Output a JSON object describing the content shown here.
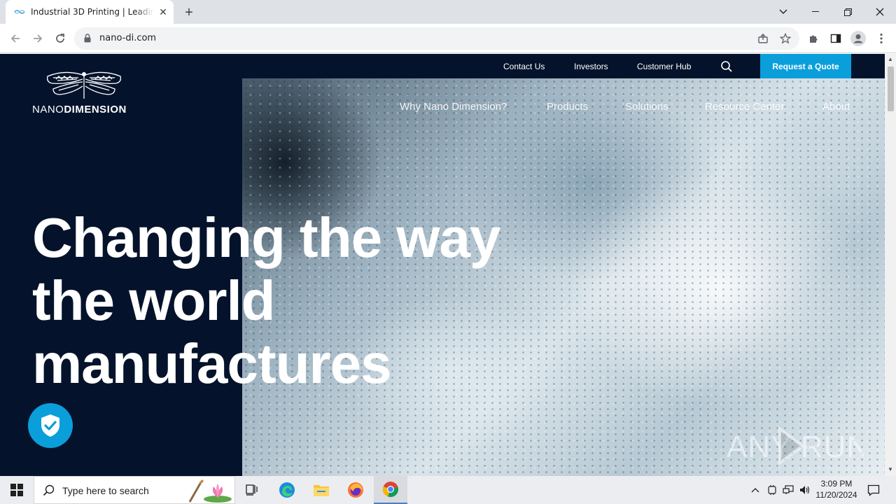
{
  "browser": {
    "tab_title": "Industrial 3D Printing | Leading in",
    "url": "nano-di.com"
  },
  "site": {
    "logo_text_left": "NANO",
    "logo_text_right": "DIMENSION",
    "utility_links": [
      "Contact Us",
      "Investors",
      "Customer Hub"
    ],
    "quote_button": "Request a Quote",
    "main_nav": [
      "Why Nano Dimension?",
      "Products",
      "Solutions",
      "Resource Center",
      "About"
    ],
    "headline_lines": [
      "Changing the way",
      "the world",
      "manufactures"
    ],
    "accent_color": "#0a9edb",
    "background_color": "#04132b"
  },
  "watermark": "ANY RUN",
  "taskbar": {
    "search_placeholder": "Type here to search",
    "time": "3:09 PM",
    "date": "11/20/2024"
  }
}
